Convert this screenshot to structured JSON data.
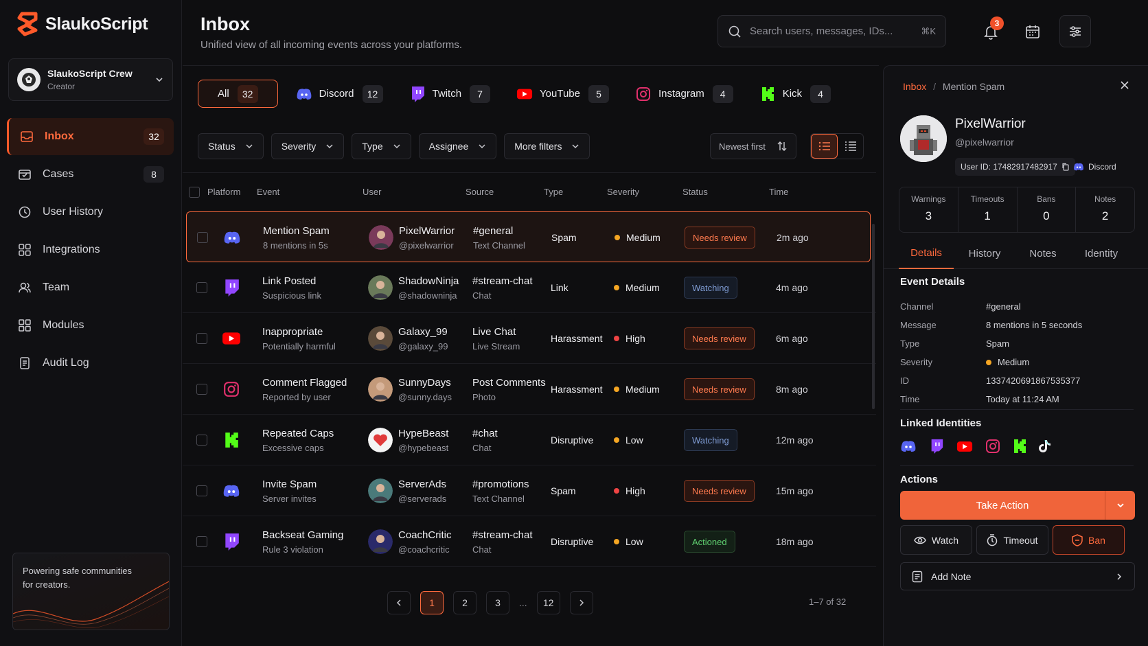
{
  "app": {
    "name": "SlaukoScript"
  },
  "workspace": {
    "name": "SlaukoScript Crew",
    "role": "Creator"
  },
  "nav": [
    {
      "label": "Inbox",
      "count": "32",
      "icon": "inbox-icon",
      "active": true
    },
    {
      "label": "Cases",
      "count": "8",
      "icon": "cases-icon"
    },
    {
      "label": "User History",
      "icon": "history-icon"
    },
    {
      "label": "Integrations",
      "icon": "integrations-icon"
    },
    {
      "label": "Team",
      "icon": "team-icon"
    },
    {
      "label": "Modules",
      "icon": "modules-icon"
    },
    {
      "label": "Audit Log",
      "icon": "audit-log-icon"
    }
  ],
  "promo": {
    "text": "Powering safe communities for creators."
  },
  "header": {
    "title": "Inbox",
    "subtitle": "Unified view of all incoming events across your platforms.",
    "search_placeholder": "Search users, messages, IDs...",
    "search_shortcut": "⌘K",
    "notifications": "3"
  },
  "platform_tabs": [
    {
      "label": "All",
      "count": "32",
      "active": true
    },
    {
      "label": "Discord",
      "count": "12",
      "icon": "discord-icon"
    },
    {
      "label": "Twitch",
      "count": "7",
      "icon": "twitch-icon"
    },
    {
      "label": "YouTube",
      "count": "5",
      "icon": "youtube-icon"
    },
    {
      "label": "Instagram",
      "count": "4",
      "icon": "instagram-icon"
    },
    {
      "label": "Kick",
      "count": "4",
      "icon": "kick-icon"
    }
  ],
  "filters": {
    "items": [
      "Status",
      "Severity",
      "Type",
      "Assignee",
      "More filters"
    ],
    "sort": "Newest first"
  },
  "table": {
    "headers": [
      "Platform",
      "Event",
      "User",
      "Source",
      "Type",
      "Severity",
      "Status",
      "Time"
    ],
    "rows": [
      {
        "platform": "discord",
        "event": "Mention Spam",
        "detail": "8 mentions in 5s",
        "user": "PixelWarrior",
        "handle": "@pixelwarrior",
        "source": "#general",
        "source_type": "Text Channel",
        "type": "Spam",
        "severity": "Medium",
        "status": "Needs review",
        "time": "2m ago"
      },
      {
        "platform": "twitch",
        "event": "Link Posted",
        "detail": "Suspicious link",
        "user": "ShadowNinja",
        "handle": "@shadowninja",
        "source": "#stream-chat",
        "source_type": "Chat",
        "type": "Link",
        "severity": "Medium",
        "status": "Watching",
        "time": "4m ago"
      },
      {
        "platform": "youtube",
        "event": "Inappropriate",
        "detail": "Potentially harmful",
        "user": "Galaxy_99",
        "handle": "@galaxy_99",
        "source": "Live Chat",
        "source_type": "Live Stream",
        "type": "Harassment",
        "severity": "High",
        "status": "Needs review",
        "time": "6m ago"
      },
      {
        "platform": "instagram",
        "event": "Comment Flagged",
        "detail": "Reported by user",
        "user": "SunnyDays",
        "handle": "@sunny.days",
        "source": "Post Comments",
        "source_type": "Photo",
        "type": "Harassment",
        "severity": "Medium",
        "status": "Needs review",
        "time": "8m ago"
      },
      {
        "platform": "kick",
        "event": "Repeated Caps",
        "detail": "Excessive caps",
        "user": "HypeBeast",
        "handle": "@hypebeast",
        "source": "#chat",
        "source_type": "Chat",
        "type": "Disruptive",
        "severity": "Low",
        "status": "Watching",
        "time": "12m ago"
      },
      {
        "platform": "discord",
        "event": "Invite Spam",
        "detail": "Server invites",
        "user": "ServerAds",
        "handle": "@serverads",
        "source": "#promotions",
        "source_type": "Text Channel",
        "type": "Spam",
        "severity": "High",
        "status": "Needs review",
        "time": "15m ago"
      },
      {
        "platform": "twitch",
        "event": "Backseat Gaming",
        "detail": "Rule 3 violation",
        "user": "CoachCritic",
        "handle": "@coachcritic",
        "source": "#stream-chat",
        "source_type": "Chat",
        "type": "Disruptive",
        "severity": "Low",
        "status": "Actioned",
        "time": "18m ago"
      }
    ]
  },
  "pagination": {
    "pages": [
      "1",
      "2",
      "3",
      "...",
      "12"
    ],
    "current": "1",
    "range": "1–7 of 32"
  },
  "detail": {
    "crumb_root": "Inbox",
    "crumb_sep": "/",
    "crumb_current": "Mention Spam",
    "name": "PixelWarrior",
    "handle": "@pixelwarrior",
    "user_id": "User ID: 17482917482917",
    "platform": "Discord",
    "stats": [
      {
        "label": "Warnings",
        "value": "3"
      },
      {
        "label": "Timeouts",
        "value": "1"
      },
      {
        "label": "Bans",
        "value": "0"
      },
      {
        "label": "Notes",
        "value": "2"
      }
    ],
    "tabs": [
      "Details",
      "History",
      "Notes",
      "Identity"
    ],
    "event_title": "Event Details",
    "event": [
      {
        "k": "Channel",
        "v": "#general"
      },
      {
        "k": "Message",
        "v": "8 mentions in 5 seconds"
      },
      {
        "k": "Type",
        "v": "Spam"
      },
      {
        "k": "Severity",
        "v": "Medium"
      },
      {
        "k": "ID",
        "v": "1337420691867535377"
      },
      {
        "k": "Time",
        "v": "Today at 11:24 AM"
      }
    ],
    "linked_title": "Linked Identities",
    "actions_title": "Actions",
    "take_action": "Take Action",
    "watch": "Watch",
    "timeout": "Timeout",
    "ban": "Ban",
    "add_note": "Add Note"
  },
  "colors": {
    "accent": "#ff6a3d",
    "medium": "#f5a623",
    "high": "#ef4444",
    "low": "#f5a623"
  }
}
